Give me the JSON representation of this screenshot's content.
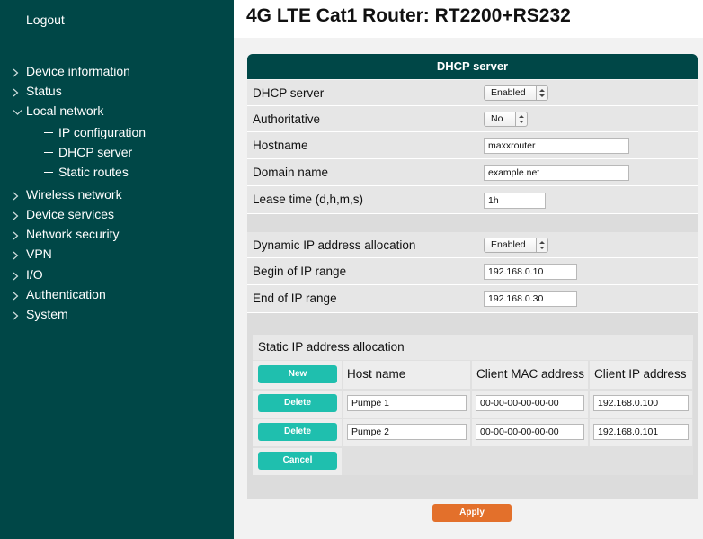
{
  "sidebar": {
    "logout": "Logout",
    "items": [
      {
        "label": "Device information"
      },
      {
        "label": "Status"
      },
      {
        "label": "Local network"
      },
      {
        "label": "Wireless network"
      },
      {
        "label": "Device services"
      },
      {
        "label": "Network security"
      },
      {
        "label": "VPN"
      },
      {
        "label": "I/O"
      },
      {
        "label": "Authentication"
      },
      {
        "label": "System"
      }
    ],
    "subitems": [
      {
        "label": "IP configuration"
      },
      {
        "label": "DHCP server"
      },
      {
        "label": "Static routes"
      }
    ]
  },
  "header": {
    "title": "4G LTE Cat1 Router: RT2200+RS232"
  },
  "panel": {
    "title": "DHCP server",
    "dhcp_server": {
      "label": "DHCP server",
      "value": "Enabled"
    },
    "authoritative": {
      "label": "Authoritative",
      "value": "No"
    },
    "hostname": {
      "label": "Hostname",
      "value": "maxxrouter"
    },
    "domain_name": {
      "label": "Domain name",
      "value": "example.net"
    },
    "lease_time": {
      "label": "Lease time (d,h,m,s)",
      "value": "1h"
    },
    "dynamic_alloc": {
      "label": "Dynamic IP address allocation",
      "value": "Enabled"
    },
    "begin_range": {
      "label": "Begin of IP range",
      "value": "192.168.0.10"
    },
    "end_range": {
      "label": "End of IP range",
      "value": "192.168.0.30"
    }
  },
  "static_alloc": {
    "title": "Static IP address allocation",
    "new_label": "New",
    "columns": [
      "Host name",
      "Client MAC address",
      "Client IP address"
    ],
    "rows": [
      {
        "delete_label": "Delete",
        "host": "Pumpe 1",
        "mac": "00-00-00-00-00-00",
        "ip": "192.168.0.100"
      },
      {
        "delete_label": "Delete",
        "host": "Pumpe 2",
        "mac": "00-00-00-00-00-00",
        "ip": "192.168.0.101"
      }
    ],
    "cancel_label": "Cancel"
  },
  "apply_label": "Apply",
  "colors": {
    "sidebar_bg": "#004747",
    "teal_button": "#1fbfae",
    "apply_button": "#e3702b"
  }
}
